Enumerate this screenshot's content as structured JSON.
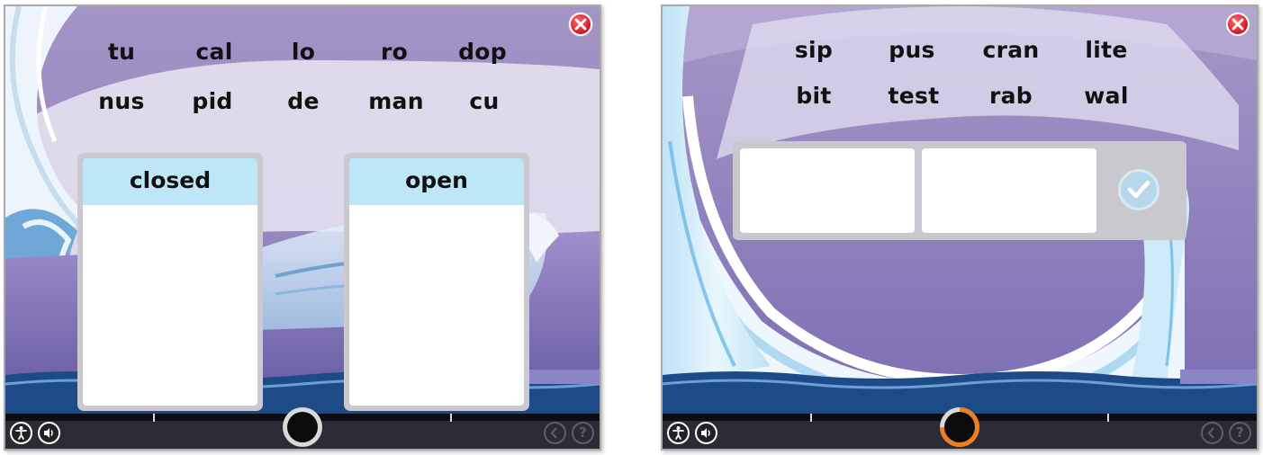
{
  "left_screen": {
    "words_row1": [
      "tu",
      "cal",
      "lo",
      "ro",
      "dop"
    ],
    "words_row2": [
      "nus",
      "pid",
      "de",
      "man",
      "cu"
    ],
    "columns": [
      {
        "label": "closed"
      },
      {
        "label": "open"
      }
    ],
    "progress": 0
  },
  "right_screen": {
    "words_row1": [
      "sip",
      "pus",
      "cran",
      "lite"
    ],
    "words_row2": [
      "bit",
      "test",
      "rab",
      "wal"
    ],
    "progress": 0.75
  },
  "toolbar": {
    "help_label": "?",
    "accent_color": "#f07d1e",
    "icons": [
      "close-icon",
      "accessibility-icon",
      "speaker-icon",
      "back-icon",
      "help-icon",
      "check-icon"
    ]
  }
}
